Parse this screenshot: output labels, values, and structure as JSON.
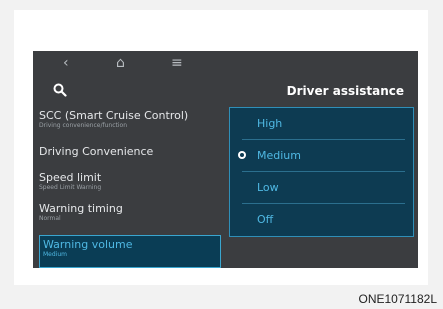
{
  "topbar": {
    "icons": [
      "back-icon",
      "home-icon",
      "menu-icon"
    ],
    "glyphs": [
      "‹",
      "⌂",
      "≡"
    ]
  },
  "header": {
    "title": "Driver assistance",
    "search_icon": "search-icon"
  },
  "menu": {
    "items": [
      {
        "label": "SCC (Smart Cruise Control)",
        "sub": "Driving convenience/function",
        "selected": false
      },
      {
        "label": "Driving Convenience",
        "sub": "",
        "selected": false
      },
      {
        "label": "Speed limit",
        "sub": "Speed Limit Warning",
        "selected": false
      },
      {
        "label": "Warning timing",
        "sub": "Normal",
        "selected": false
      },
      {
        "label": "Warning volume",
        "sub": "Medium",
        "selected": true
      }
    ]
  },
  "options": {
    "items": [
      {
        "label": "High",
        "selected": false
      },
      {
        "label": "Medium",
        "selected": true
      },
      {
        "label": "Low",
        "selected": false
      },
      {
        "label": "Off",
        "selected": false
      }
    ]
  },
  "caption": "ONE1071182L",
  "colors": {
    "accent": "#4fb8e3",
    "panel": "#0d3b52",
    "screen": "#3b3d40"
  }
}
